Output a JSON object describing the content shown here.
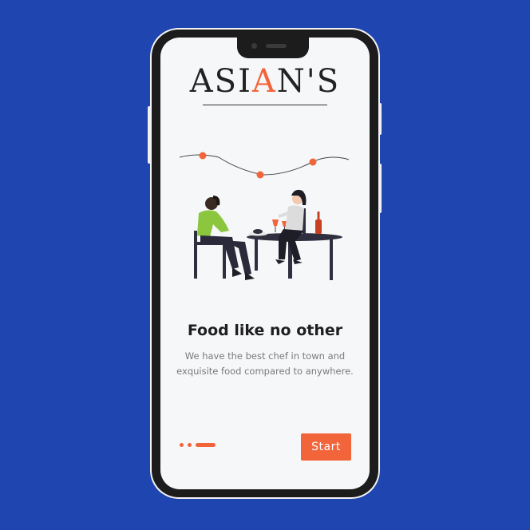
{
  "app": {
    "logo_part1": "ASI",
    "logo_accent": "A",
    "logo_part2": "N'S"
  },
  "onboarding": {
    "title": "Food like no other",
    "description": "We have the best chef in town and exquisite food compared to anywhere.",
    "start_label": "Start",
    "current_page": 3,
    "total_pages": 3
  },
  "colors": {
    "background": "#1f45b0",
    "accent": "#f2643a",
    "screen": "#f6f7f9"
  }
}
